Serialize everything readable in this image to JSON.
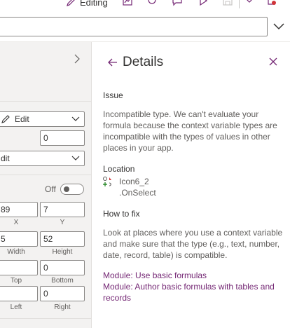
{
  "toolbar": {
    "editing_label": "Editing"
  },
  "properties_panel": {
    "edit_select_value": "Edit",
    "number_field_value": "0",
    "display_mode_value": "dit",
    "toggle_label": "Off",
    "x_value": "89",
    "y_value": "7",
    "x_caption": "X",
    "y_caption": "Y",
    "width_value": "5",
    "height_value": "52",
    "width_caption": "Width",
    "height_caption": "Height",
    "top_value": "",
    "bottom_value": "0",
    "top_caption": "Top",
    "bottom_caption": "Bottom",
    "left_value": "",
    "right_value": "0",
    "left_caption": "Left",
    "right_caption": "Right"
  },
  "details": {
    "title": "Details",
    "issue_heading": "Issue",
    "issue_text": "Incompatible type. We can't evaluate your formula because the context variable types are incompatible with the types of values in other places in your app.",
    "location_heading": "Location",
    "location_control": "Icon6_2",
    "location_property": ".OnSelect",
    "howtofix_heading": "How to fix",
    "howtofix_text": "Look at places where you use a context variable and make sure that the type (e.g., text, number, date, record, table) is compatible.",
    "links": [
      "Module: Use basic formulas",
      "Module: Author basic formulas with tables and records"
    ]
  },
  "colors": {
    "accent": "#742774",
    "panel_bg": "#f3f2f1"
  },
  "icons": {
    "edit": "pencil-icon",
    "back": "arrow-left-icon",
    "close": "close-icon",
    "location": "control-icon"
  }
}
